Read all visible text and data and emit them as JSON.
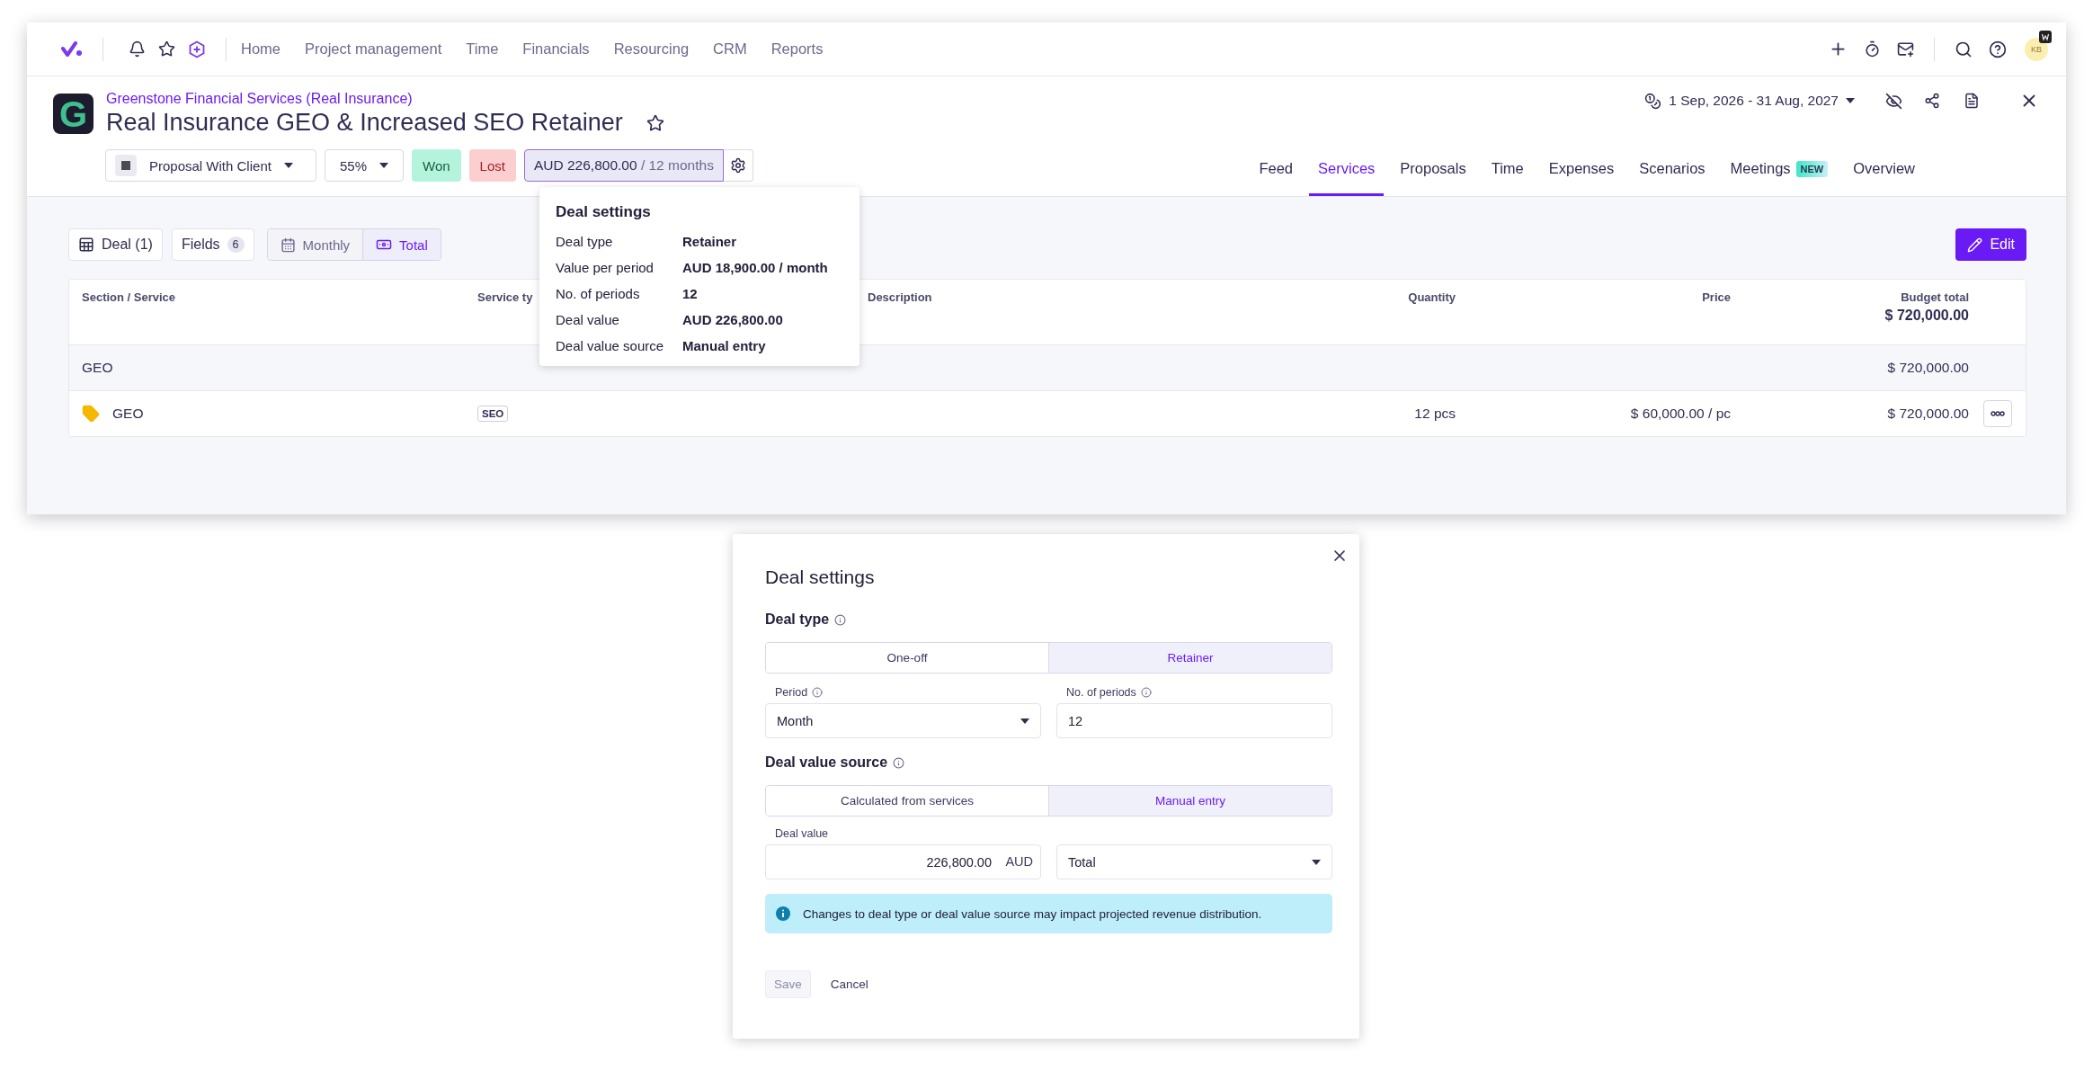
{
  "nav": {
    "items": [
      {
        "label": "Home"
      },
      {
        "label": "Project management"
      },
      {
        "label": "Time"
      },
      {
        "label": "Financials"
      },
      {
        "label": "Resourcing"
      },
      {
        "label": "CRM"
      },
      {
        "label": "Reports"
      }
    ],
    "avatar": "KB"
  },
  "header": {
    "logo_letter": "G",
    "company": "Greenstone Financial Services (Real Insurance)",
    "title": "Real Insurance GEO & Increased SEO Retainer",
    "starred": false,
    "date_range": "1 Sep, 2026 - 31 Aug, 2027",
    "stage": "Proposal With Client",
    "probability": "55%",
    "won": "Won",
    "lost": "Lost",
    "amount": "AUD 226,800.00",
    "amount_period": "/ 12 months"
  },
  "tabs": [
    {
      "label": "Feed",
      "selected": false
    },
    {
      "label": "Services",
      "selected": true
    },
    {
      "label": "Proposals",
      "selected": false
    },
    {
      "label": "Time",
      "selected": false
    },
    {
      "label": "Expenses",
      "selected": false
    },
    {
      "label": "Scenarios",
      "selected": false
    },
    {
      "label": "Meetings",
      "selected": false,
      "badge": "NEW"
    },
    {
      "label": "Overview",
      "selected": false
    }
  ],
  "toolbar": {
    "deal": "Deal (1)",
    "fields": "Fields",
    "fields_count": "6",
    "views": [
      {
        "label": "Monthly",
        "selected": false
      },
      {
        "label": "Total",
        "selected": true
      }
    ],
    "edit": "Edit"
  },
  "table": {
    "columns": [
      {
        "label": "Section / Service"
      },
      {
        "label": "Service ty"
      },
      {
        "label": "Description"
      },
      {
        "label": "Quantity"
      },
      {
        "label": "Price"
      },
      {
        "label": "Budget total",
        "total": "$ 720,000.00"
      }
    ],
    "rows": [
      {
        "kind": "section",
        "name": "GEO",
        "budget": "$ 720,000.00"
      },
      {
        "kind": "service",
        "name": "GEO",
        "type": "SEO",
        "quantity": "12 pcs",
        "price": "$ 60,000.00 / pc",
        "budget": "$ 720,000.00"
      }
    ]
  },
  "popover": {
    "title": "Deal settings",
    "rows": [
      {
        "label": "Deal type",
        "value": "Retainer"
      },
      {
        "label": "Value per period",
        "value": "AUD 18,900.00 / month"
      },
      {
        "label": "No. of periods",
        "value": "12"
      },
      {
        "label": "Deal value",
        "value": "AUD 226,800.00"
      },
      {
        "label": "Deal value source",
        "value": "Manual entry"
      }
    ]
  },
  "modal": {
    "title": "Deal settings",
    "deal_type": {
      "label": "Deal type",
      "options": [
        {
          "label": "One-off",
          "selected": false
        },
        {
          "label": "Retainer",
          "selected": true
        }
      ]
    },
    "period": {
      "label": "Period",
      "value": "Month"
    },
    "periods": {
      "label": "No. of periods",
      "value": "12"
    },
    "value_source": {
      "label": "Deal value source",
      "options": [
        {
          "label": "Calculated from services",
          "selected": false
        },
        {
          "label": "Manual entry",
          "selected": true
        }
      ]
    },
    "deal_value": {
      "label": "Deal value",
      "value": "226,800.00",
      "currency": "AUD"
    },
    "scope": {
      "value": "Total"
    },
    "alert": "Changes to deal type or deal value source may impact projected revenue distribution.",
    "save": {
      "label": "Save",
      "disabled": true
    },
    "cancel": {
      "label": "Cancel"
    }
  }
}
